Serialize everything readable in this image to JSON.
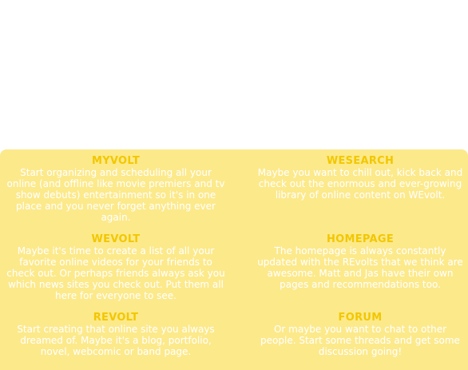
{
  "colors": {
    "panel_background": "#fce98a",
    "title_color": "#f2c700",
    "description_color": "#ffffff"
  },
  "sections": [
    {
      "title": "MYVOLT",
      "description": "Start organizing and scheduling all your online (and offline like movie premiers and tv show debuts) entertainment so it's in one place and you never forget anything ever again."
    },
    {
      "title": "WESEARCH",
      "description": "Maybe you want to chill out, kick back and check out the enormous and ever-growing library of online content on WEvolt."
    },
    {
      "title": "WEVOLT",
      "description": "Maybe it's time to create a list of all your favorite online videos for your friends to check out. Or perhaps friends always ask you which news sites you check out. Put them all here for everyone to see."
    },
    {
      "title": "HOMEPAGE",
      "description": "The homepage is always constantly updated with the REvolts that we think are awesome. Matt and Jas have their own pages and recommendations too."
    },
    {
      "title": "REVOLT",
      "description": "Start creating that online site you always dreamed of. Maybe it's a blog, portfolio, novel, webcomic or band page."
    },
    {
      "title": "FORUM",
      "description": "Or maybe you want to chat to other people. Start some threads and get some discussion going!"
    }
  ]
}
